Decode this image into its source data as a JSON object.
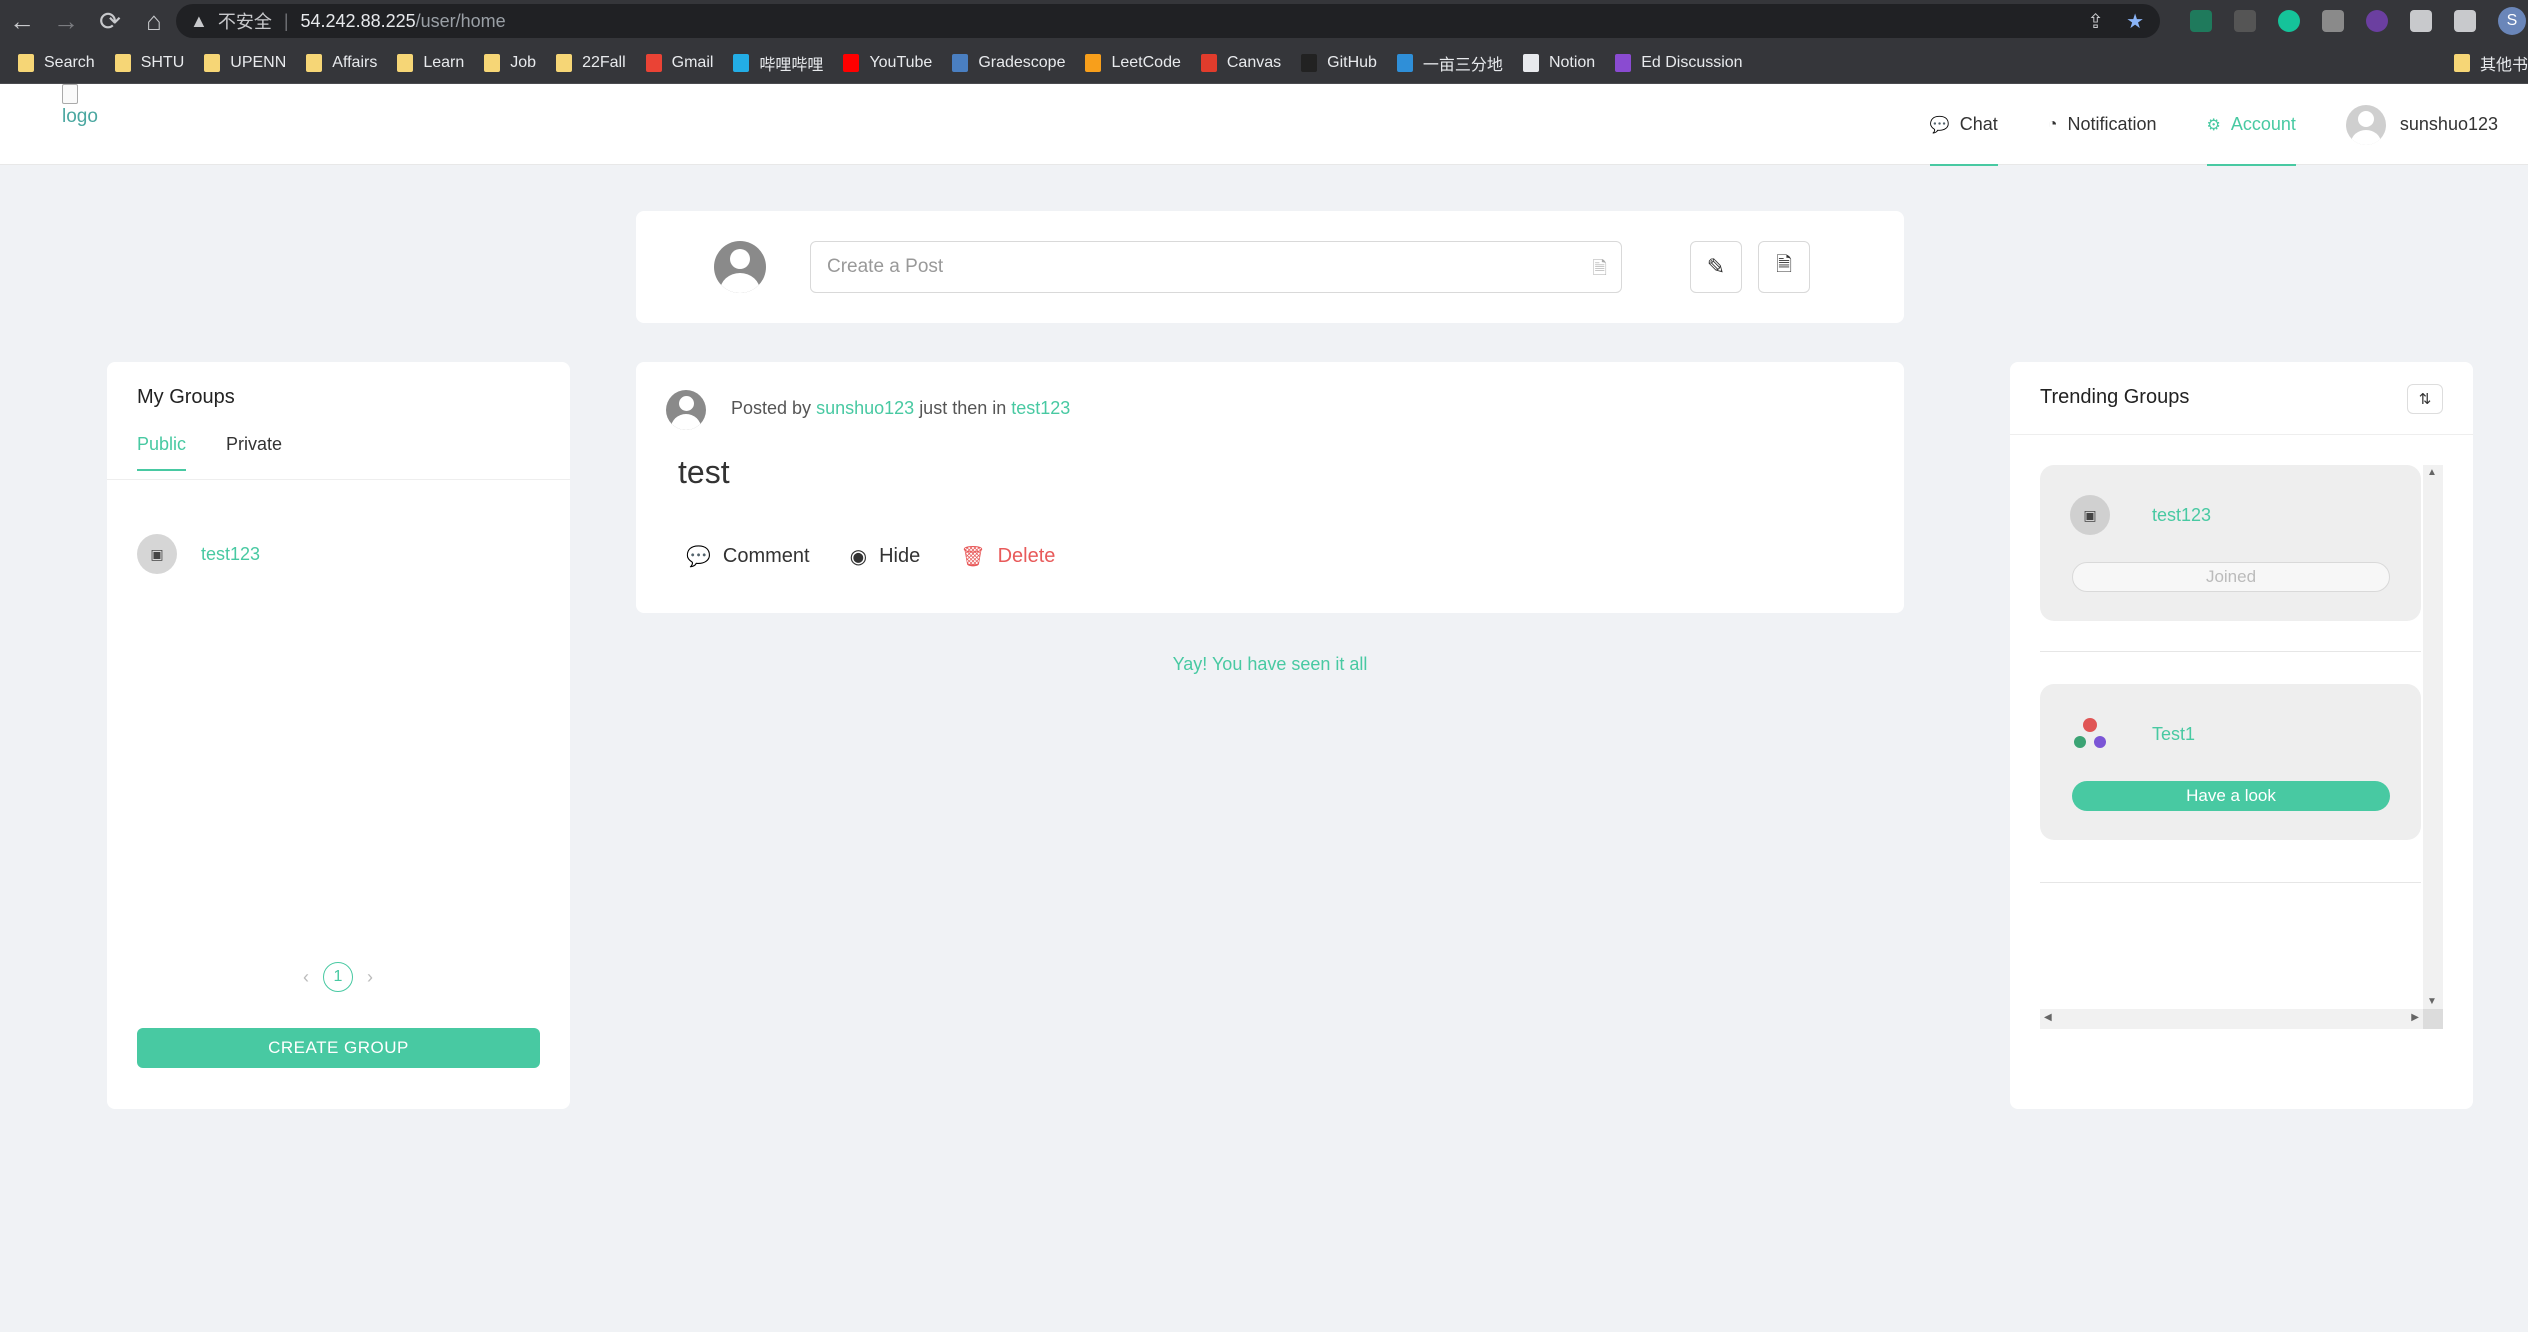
{
  "browser": {
    "nav": {
      "back": "←",
      "forward": "→",
      "reload": "⟳",
      "home": "⌂"
    },
    "address": {
      "warning": "▲",
      "insecure": "不安全",
      "separator": "|",
      "host": "54.242.88.225",
      "path": "/user/home"
    },
    "profile_initial": "S",
    "bookmarks": [
      {
        "label": "Search",
        "icon": "folder-icon"
      },
      {
        "label": "SHTU",
        "icon": "folder-icon"
      },
      {
        "label": "UPENN",
        "icon": "folder-icon"
      },
      {
        "label": "Affairs",
        "icon": "folder-icon"
      },
      {
        "label": "Learn",
        "icon": "folder-icon"
      },
      {
        "label": "Job",
        "icon": "folder-icon"
      },
      {
        "label": "22Fall",
        "icon": "folder-icon"
      },
      {
        "label": "Gmail",
        "icon": "gmail-icon"
      },
      {
        "label": "哔哩哔哩",
        "icon": "bilibili-icon"
      },
      {
        "label": "YouTube",
        "icon": "youtube-icon"
      },
      {
        "label": "Gradescope",
        "icon": "gradescope-icon"
      },
      {
        "label": "LeetCode",
        "icon": "leetcode-icon"
      },
      {
        "label": "Canvas",
        "icon": "canvas-icon"
      },
      {
        "label": "GitHub",
        "icon": "github-icon"
      },
      {
        "label": "一亩三分地",
        "icon": "1point3acres-icon"
      },
      {
        "label": "Notion",
        "icon": "notion-icon"
      },
      {
        "label": "Ed Discussion",
        "icon": "ed-icon"
      }
    ],
    "bookmarks_overflow": "其他书"
  },
  "header": {
    "logo_alt": "logo",
    "nav": {
      "chat": "Chat",
      "notification": "Notification",
      "account": "Account"
    },
    "username": "sunshuo123"
  },
  "composer": {
    "placeholder": "Create a Post"
  },
  "my_groups": {
    "title": "My Groups",
    "tabs": {
      "public": "Public",
      "private": "Private"
    },
    "groups": [
      {
        "name": "test123"
      }
    ],
    "pagination": {
      "prev": "‹",
      "page": "1",
      "next": "›"
    },
    "create_label": "CREATE GROUP"
  },
  "post": {
    "posted_by": "Posted by",
    "author": "sunshuo123",
    "time_in": "just then in",
    "group": "test123",
    "title": "test",
    "actions": {
      "comment": "Comment",
      "hide": "Hide",
      "delete": "Delete"
    }
  },
  "feed_end": "Yay! You have seen it all",
  "trending": {
    "title": "Trending Groups",
    "groups": [
      {
        "name": "test123",
        "button": "Joined"
      },
      {
        "name": "Test1",
        "button": "Have a look"
      }
    ]
  },
  "colors": {
    "accent": "#48c9a2",
    "danger": "#e85a5a",
    "page_bg": "#f0f2f5"
  }
}
